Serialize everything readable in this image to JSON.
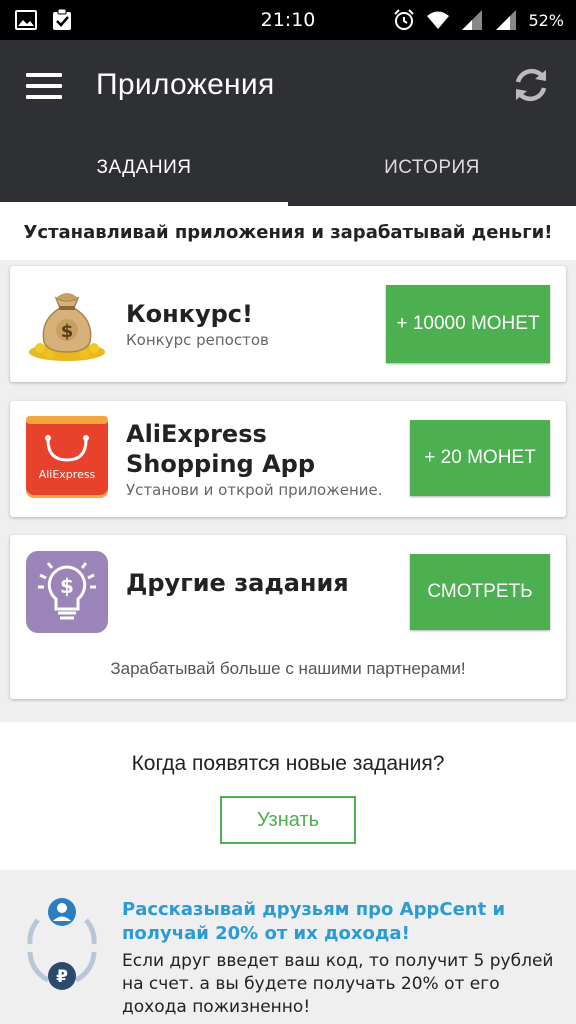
{
  "statusbar": {
    "time": "21:10",
    "battery": "52%",
    "icons_left": [
      "image-icon",
      "clipboard-check-icon"
    ],
    "icons_right": [
      "alarm-icon",
      "wifi-icon",
      "signal-icon",
      "signal-icon"
    ]
  },
  "appbar": {
    "title": "Приложения"
  },
  "tabs": [
    {
      "label": "ЗАДАНИЯ",
      "active": true
    },
    {
      "label": "ИСТОРИЯ",
      "active": false
    }
  ],
  "promo_text": "Устанавливай приложения и зарабатывай деньги!",
  "cards": [
    {
      "title": "Конкурс!",
      "subtitle": "Конкурс репостов",
      "button": "+ 10000 МОНЕТ",
      "icon": "money-bag-icon"
    },
    {
      "title": "AliExpress Shopping App",
      "subtitle": "Установи и открой приложение.",
      "button": "+ 20 МОНЕТ",
      "icon": "aliexpress-icon",
      "icon_text": "AliExpress"
    },
    {
      "title": "Другие задания",
      "subtitle": "Зарабатывай больше с нашими партнерами!",
      "button": "СМОТРЕТЬ",
      "icon": "lightbulb-dollar-icon"
    }
  ],
  "new_tasks": {
    "question": "Когда появятся новые задания?",
    "button": "Узнать"
  },
  "referral": {
    "title": "Рассказывай друзьям про AppCent и получай 20% от их дохода!",
    "text": "Если друг введет ваш код, то получит 5 рублей на счет. а вы будете получать 20% от его дохода пожизненно!"
  },
  "colors": {
    "appbar": "#2f3034",
    "green": "#4caf50",
    "link_blue": "#2b9bd4",
    "aliexpress_red": "#e8412c",
    "purple": "#9a84b8"
  }
}
